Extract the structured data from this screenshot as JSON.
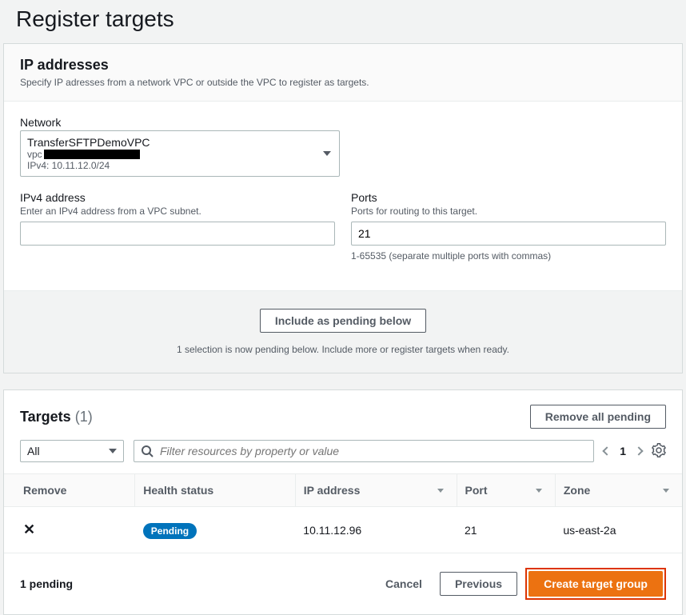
{
  "page": {
    "title": "Register targets"
  },
  "ip_panel": {
    "title": "IP addresses",
    "desc": "Specify IP adresses from a network VPC or outside the VPC to register as targets.",
    "network_label": "Network",
    "network_dd": {
      "name": "TransferSFTPDemoVPC",
      "vpc_prefix": "vpc",
      "cidr": "IPv4: 10.11.12.0/24"
    },
    "ipv4_label": "IPv4 address",
    "ipv4_hint": "Enter an IPv4 address from a VPC subnet.",
    "ipv4_value": "",
    "ports_label": "Ports",
    "ports_hint": "Ports for routing to this target.",
    "ports_value": "21",
    "ports_range": "1-65535 (separate multiple ports with commas)",
    "include_btn": "Include as pending below",
    "include_hint": "1 selection is now pending below. Include more or register targets when ready."
  },
  "targets": {
    "title": "Targets",
    "count_display": "(1)",
    "remove_all": "Remove all pending",
    "filter_label": "All",
    "search_placeholder": "Filter resources by property or value",
    "page_num": "1",
    "columns": {
      "remove": "Remove",
      "health": "Health status",
      "ip": "IP address",
      "port": "Port",
      "zone": "Zone"
    },
    "rows": [
      {
        "health": "Pending",
        "ip": "10.11.12.96",
        "port": "21",
        "zone": "us-east-2a"
      }
    ]
  },
  "footer": {
    "pending": "1 pending",
    "cancel": "Cancel",
    "previous": "Previous",
    "create": "Create target group"
  }
}
